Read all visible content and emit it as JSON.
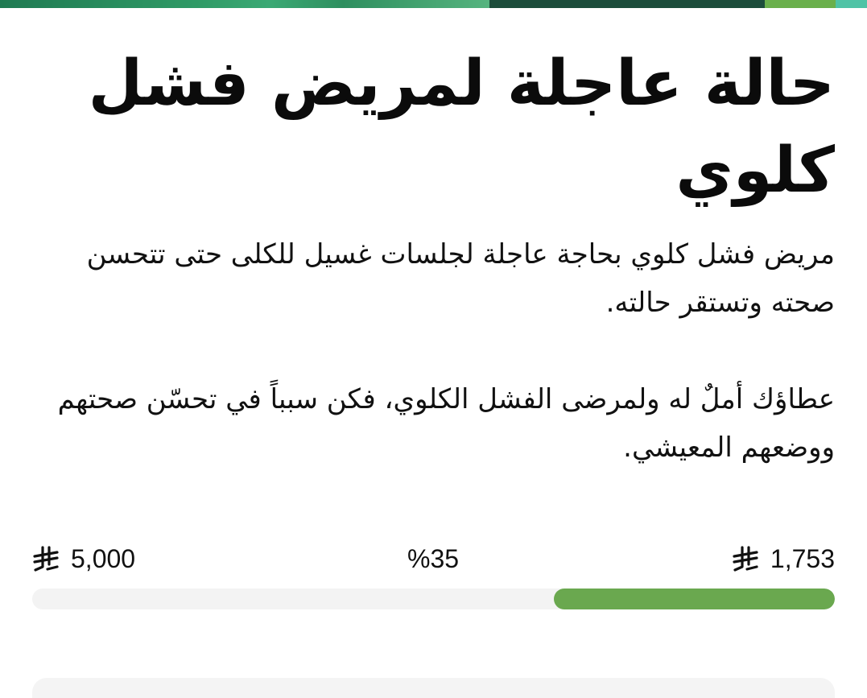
{
  "campaign": {
    "title": "حالة عاجلة لمريض فشل كلوي",
    "description_1": "مريض فشل كلوي بحاجة عاجلة لجلسات غسيل للكلى حتى تتحسن صحته وتستقر حالته.",
    "description_2": "عطاؤك أملٌ له ولمرضى الفشل الكلوي، فكن سبباً في تحسّن صحتهم ووضعهم المعيشي."
  },
  "progress": {
    "goal_amount": "5,000",
    "percent_label": "%35",
    "raised_amount": "1,753",
    "fraction": 0.35,
    "currency_icon": "saudi-riyal-icon",
    "fill_color": "#6aa84f",
    "track_color": "#f3f3f3"
  },
  "banner": {
    "colors": [
      "#2f9a66",
      "#1c4d3b",
      "#6ab04c",
      "#4fc3a6"
    ]
  }
}
